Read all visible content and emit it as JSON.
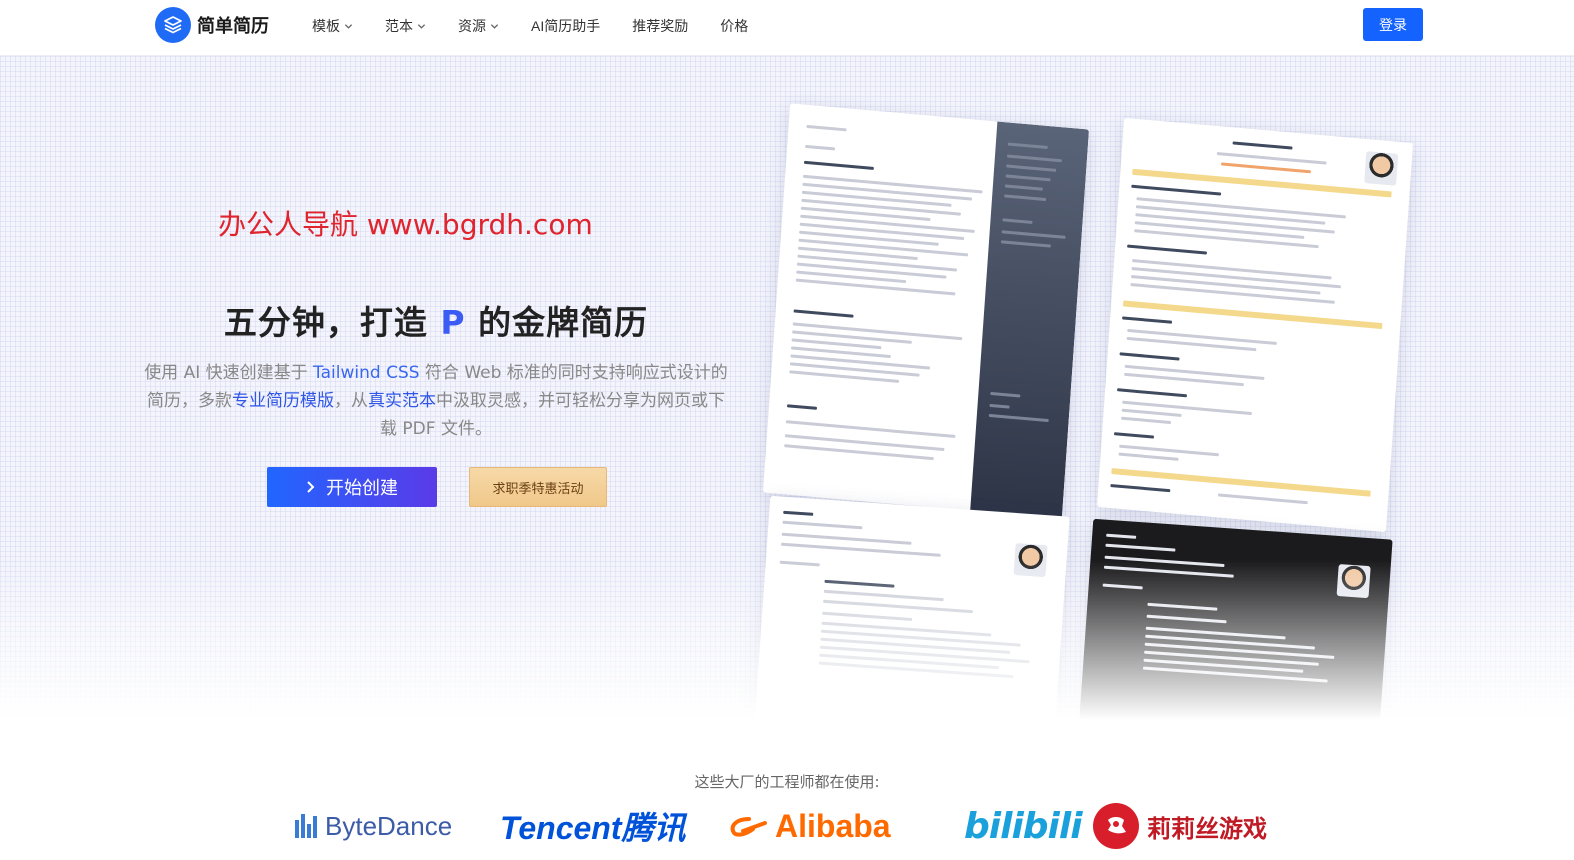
{
  "nav": {
    "brand": "简单简历",
    "menu": [
      {
        "label": "模板",
        "has_dropdown": true
      },
      {
        "label": "范本",
        "has_dropdown": true
      },
      {
        "label": "资源",
        "has_dropdown": true
      },
      {
        "label": "AI简历助手",
        "has_dropdown": false
      },
      {
        "label": "推荐奖励",
        "has_dropdown": false
      },
      {
        "label": "价格",
        "has_dropdown": false
      }
    ],
    "login_label": "登录"
  },
  "hero": {
    "watermark": "办公人导航 www.bgrdh.com",
    "headline_prefix": "五分钟，打造",
    "headline_accent": "P",
    "headline_suffix": "的金牌简历",
    "sub_1": "使用 AI 快速创建基于 ",
    "sub_link_1": "Tailwind CSS",
    "sub_2": " 符合 Web 标准的同时支持响应式设计的简历，多款",
    "sub_link_2": "专业简历模版",
    "sub_3": "，从",
    "sub_link_3": "真实范本",
    "sub_4": "中汲取灵感，并可轻松分享为网页或下载 PDF 文件。",
    "primary_button": "开始创建",
    "secondary_button": "求职季特惠活动"
  },
  "logos": {
    "title": "这些大厂的工程师都在使用:",
    "bytedance": "ByteDance",
    "tencent": "Tencent腾讯",
    "alibaba": "Alibaba",
    "bilibili": "bilibili",
    "lilith": "莉莉丝游戏"
  },
  "colors": {
    "brand_blue": "#1463ff",
    "accent_purple": "#5a3be8",
    "watermark_red": "#e0242d",
    "promo_gold": "#f0c88a"
  }
}
